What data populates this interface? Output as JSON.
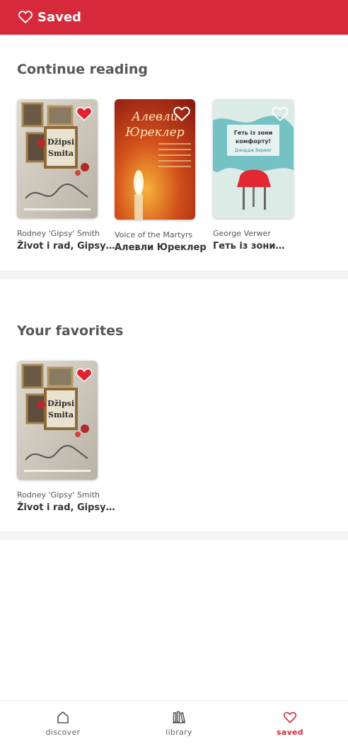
{
  "header": {
    "title": "Saved",
    "icon": "heart-outline-icon",
    "bg_color": "#d6293b"
  },
  "continue_reading": {
    "title": "Continue reading",
    "books": [
      {
        "author": "Rodney 'Gipsy' Smith",
        "title": "Život i rad, Gipsy…",
        "cover_title": "Džipsi Smita",
        "favorited": true
      },
      {
        "author": "Voice of the Martyrs",
        "title": "Алевли Юреклер",
        "cover_title": "Алевли Юреклер",
        "favorited": false
      },
      {
        "author": "George Verwer",
        "title": "Геть із зони…",
        "cover_title": "Геть із зони комфорту!",
        "favorited": false
      }
    ]
  },
  "favorites": {
    "title": "Your favorites",
    "books": [
      {
        "author": "Rodney 'Gipsy' Smith",
        "title": "Život i rad, Gipsy…",
        "cover_title": "Džipsi Smita",
        "favorited": true
      }
    ]
  },
  "bottom_nav": {
    "items": [
      {
        "label": "discover",
        "icon": "home-icon",
        "active": false
      },
      {
        "label": "library",
        "icon": "library-icon",
        "active": false
      },
      {
        "label": "saved",
        "icon": "heart-icon",
        "active": true
      }
    ]
  },
  "colors": {
    "accent": "#d6293b",
    "text_muted": "#575757",
    "divider": "#f4f4f4"
  }
}
